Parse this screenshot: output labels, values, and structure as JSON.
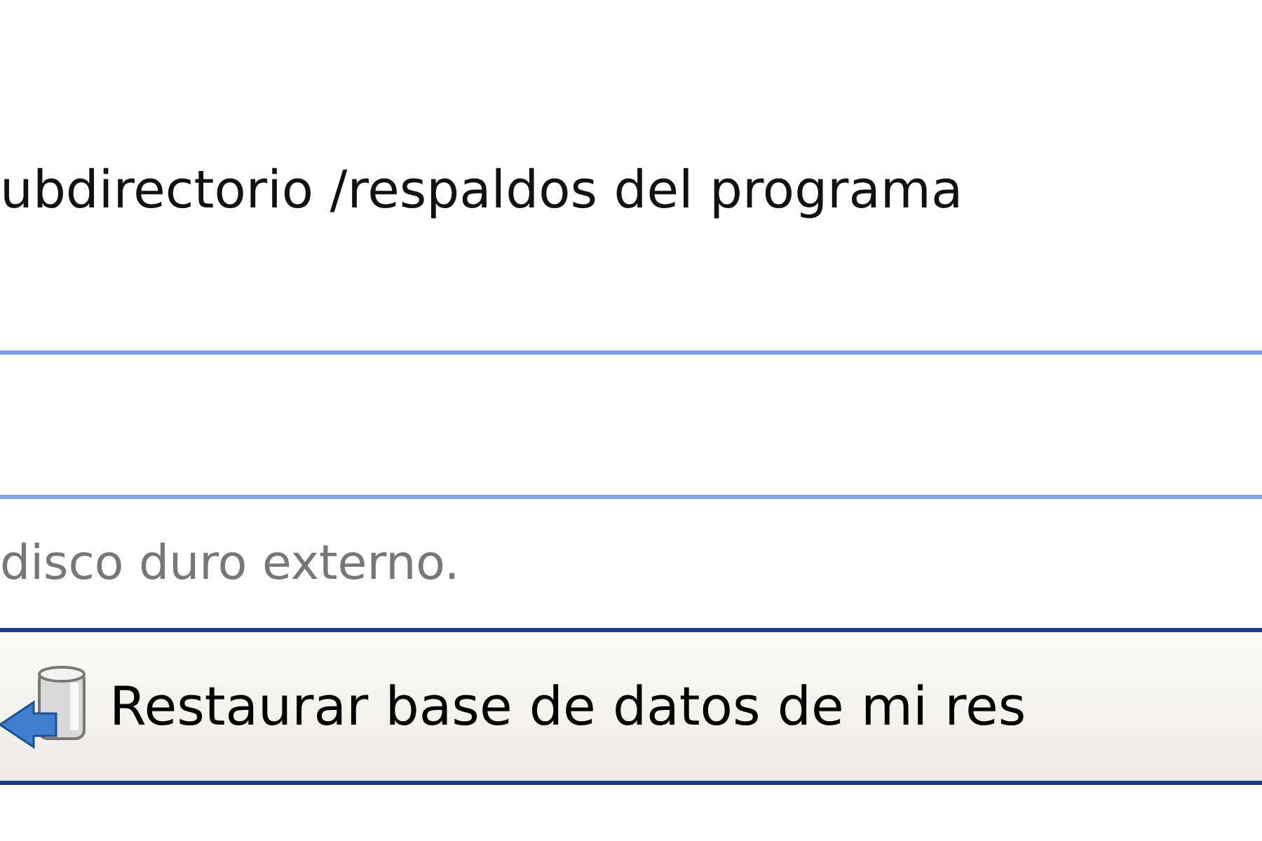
{
  "heading": "ubdirectorio /respaldos del programa",
  "note": "disco duro externo.",
  "restore_button": {
    "label": "Restaurar base de datos de mi res"
  }
}
